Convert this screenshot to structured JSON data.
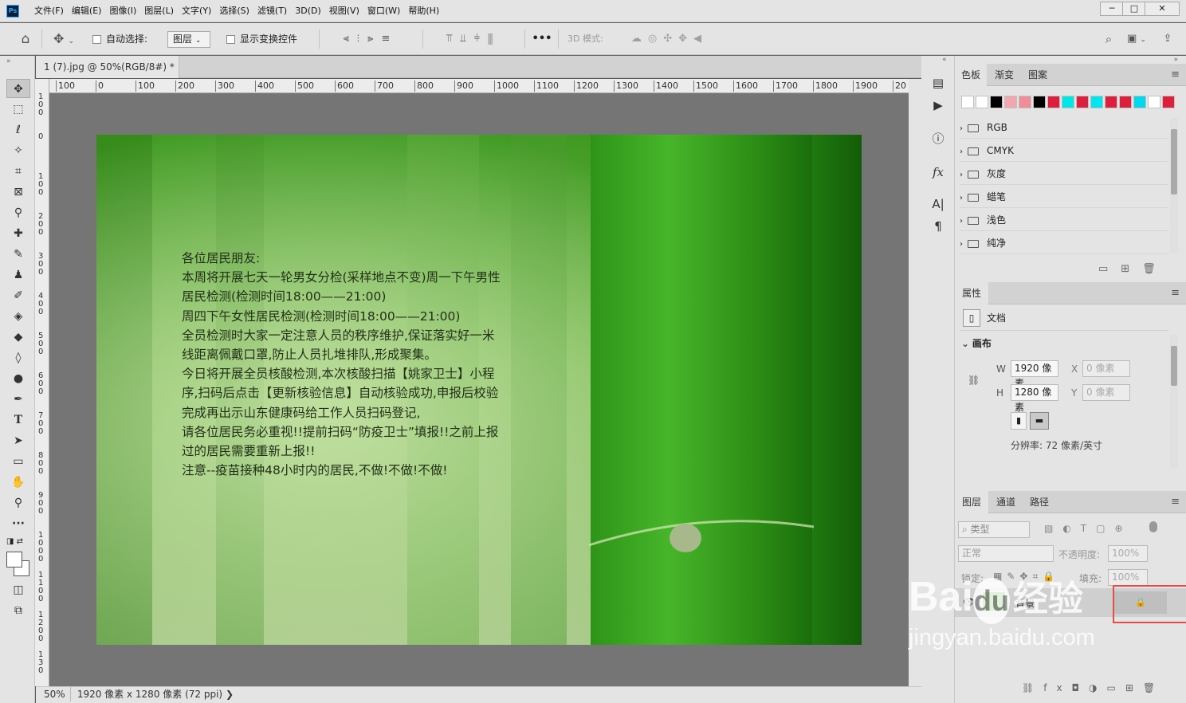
{
  "app": {
    "logo": "Ps"
  },
  "menu": [
    "文件(F)",
    "编辑(E)",
    "图像(I)",
    "图层(L)",
    "文字(Y)",
    "选择(S)",
    "滤镜(T)",
    "3D(D)",
    "视图(V)",
    "窗口(W)",
    "帮助(H)"
  ],
  "window_buttons": {
    "minimize": "─",
    "restore": "□",
    "close": "✕"
  },
  "options_bar": {
    "auto_select_label": "自动选择:",
    "auto_select_value": "图层",
    "transform_controls_label": "显示变换控件",
    "more": "•••",
    "mode_3d_label": "3D 模式:"
  },
  "document": {
    "tab_title": "1 (7).jpg @ 50%(RGB/8#) *",
    "close_glyph": "×",
    "ruler_h": [
      "100",
      "0",
      "100",
      "200",
      "300",
      "400",
      "500",
      "600",
      "700",
      "800",
      "900",
      "1000",
      "1100",
      "1200",
      "1300",
      "1400",
      "1500",
      "1600",
      "1700",
      "1800",
      "1900",
      "20"
    ],
    "ruler_v": [
      "1\n0\n0",
      "0",
      "1\n0\n0",
      "2\n0\n0",
      "3\n0\n0",
      "4\n0\n0",
      "5\n0\n0",
      "6\n0\n0",
      "7\n0\n0",
      "8\n0\n0",
      "9\n0\n0",
      "1\n0\n0\n0",
      "1\n1\n0\n0",
      "1\n2\n0\n0",
      "1\n3\n0"
    ],
    "canvas_text": [
      "各位居民朋友:",
      "本周将开展七天一轮男女分检(采样地点不变)周一下午男性居民检测(检测时间18:00——21:00)",
      "周四下午女性居民检测(检测时间18:00——21:00)",
      "全员检测时大家一定注意人员的秩序维护,保证落实好一米线距离佩戴口罩,防止人员扎堆排队,形成聚集。",
      "今日将开展全员核酸检测,本次核酸扫描【姚家卫士】小程序,扫码后点击【更新核验信息】自动核验成功,申报后校验完成再出示山东健康码给工作人员扫码登记,",
      "请各位居民务必重视!!提前扫码“防疫卫士”填报!!之前上报过的居民需要重新上报!!",
      "注意--疫苗接种48小时内的居民,不做!不做!不做!"
    ]
  },
  "status": {
    "zoom": "50%",
    "info": "1920 像素 x 1280 像素 (72 ppi)",
    "arrow": "❯"
  },
  "swatches_panel": {
    "tabs": [
      "色板",
      "渐变",
      "图案"
    ],
    "colors": [
      "#ffffff",
      "#ffffff",
      "#000000",
      "#f4a6ae",
      "#f08d96",
      "#000000",
      "#dd1f3d",
      "#00e6e6",
      "#dd1f3d",
      "#00e5f0",
      "#dd1f3d",
      "#dd1f3d",
      "#00d8f0",
      "#ffffff",
      "#dd1f3d"
    ],
    "groups": [
      "RGB",
      "CMYK",
      "灰度",
      "蜡笔",
      "浅色",
      "纯净"
    ]
  },
  "properties_panel": {
    "tab": "属性",
    "doc_label": "文档",
    "section": "画布",
    "w_label": "W",
    "w_value": "1920 像素",
    "h_label": "H",
    "h_value": "1280 像素",
    "x_label": "X",
    "x_value": "0 像素",
    "y_label": "Y",
    "y_value": "0 像素",
    "resolution": "分辨率: 72 像素/英寸"
  },
  "layers_panel": {
    "tabs": [
      "图层",
      "通道",
      "路径"
    ],
    "filter_kind": "类型",
    "blend_mode": "正常",
    "opacity_label": "不透明度:",
    "opacity_value": "100%",
    "lock_label": "锁定:",
    "fill_label": "填充:",
    "fill_value": "100%",
    "layers": [
      {
        "name": "背景",
        "visible": true,
        "locked": true
      }
    ]
  },
  "watermark": {
    "brand": "Bai",
    "paw": "du",
    "cn": "经验",
    "url": "jingyan.baidu.com"
  }
}
